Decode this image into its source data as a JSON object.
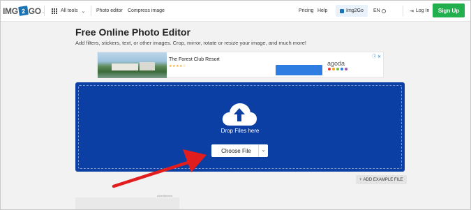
{
  "nav": {
    "logo": {
      "part1": "IMG",
      "part2": "2",
      "part3": "GO",
      "tm": "™"
    },
    "all_tools": "All tools",
    "links": [
      "Photo editor",
      "Compress image"
    ],
    "pricing": "Pricing",
    "help": "Help",
    "img2go": "Img2Go",
    "lang": "EN",
    "login": "Log In",
    "signup": "Sign Up"
  },
  "page": {
    "title": "Free Online Photo Editor",
    "subtitle": "Add filters, stickers, text, or other images. Crop, mirror, rotate or resize your image, and much more!"
  },
  "ad": {
    "name": "The Forest Club Resort",
    "stars": "★★★★☆",
    "brand": "agoda",
    "close": "ⓘ ✕",
    "dot_colors": [
      "#e5393b",
      "#f5a623",
      "#7ac143",
      "#2f7de1",
      "#9b59b6"
    ]
  },
  "upload": {
    "drop_text": "Drop Files here",
    "choose_label": "Choose File",
    "dropdown_icon": "chevron-down"
  },
  "example_label": "ADD EXAMPLE FILE",
  "advert_label": "advertisement",
  "colors": {
    "upload_bg": "#0b3fa4",
    "signup": "#22b04e",
    "arrow": "#e11d1d"
  }
}
